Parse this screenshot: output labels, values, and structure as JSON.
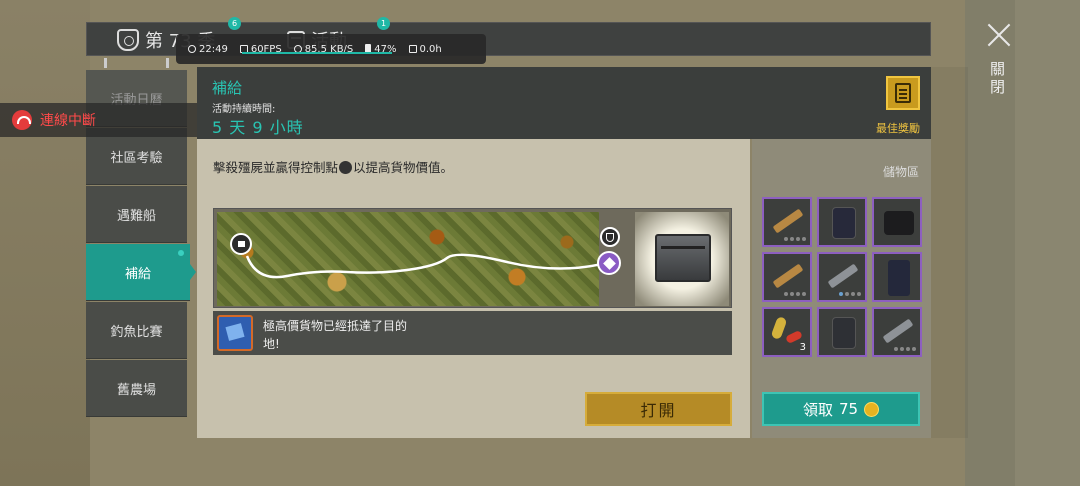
{
  "top_tabs": {
    "season_label": "第 73 季",
    "season_badge": "6",
    "event_label": "活動",
    "event_badge": "1"
  },
  "status_bar": {
    "time": "22:49",
    "fps": "60FPS",
    "network": "85.5 KB/S",
    "battery": "47%",
    "storage": "0.0h"
  },
  "close": {
    "label": "關閉"
  },
  "connection": {
    "text": "連線中斷"
  },
  "sidebar": {
    "items": [
      {
        "label": "活動日曆",
        "active": false
      },
      {
        "label": "社區考驗",
        "active": false
      },
      {
        "label": "遇難船",
        "active": false
      },
      {
        "label": "補給",
        "active": true
      },
      {
        "label": "釣魚比賽",
        "active": false
      },
      {
        "label": "舊農場",
        "active": false
      }
    ]
  },
  "header": {
    "title": "補給",
    "duration_label": "活動持續時間:",
    "duration_value": "5 天 9 小時",
    "reward_label": "最佳獎勵"
  },
  "main": {
    "description_part1": "擊殺殭屍並贏得控制點",
    "description_part2": "以提高貨物價值。",
    "message": "極高價貨物已經抵達了目的地!",
    "open_button": "打開"
  },
  "storage": {
    "label": "儲物區",
    "items": [
      {
        "type": "rifle",
        "count": ""
      },
      {
        "type": "vest",
        "count": ""
      },
      {
        "type": "boots",
        "count": ""
      },
      {
        "type": "rifle",
        "count": ""
      },
      {
        "type": "rifle-dark",
        "count": ""
      },
      {
        "type": "pants",
        "count": ""
      },
      {
        "type": "ammo",
        "count": "3"
      },
      {
        "type": "armor",
        "count": ""
      },
      {
        "type": "rifle-dark",
        "count": ""
      }
    ],
    "claim_label": "領取",
    "claim_cost": "75"
  },
  "colors": {
    "accent": "#1e9b8d",
    "title_teal": "#29c4b2",
    "gold": "#b58b26",
    "error_red": "#ff4a4a",
    "rarity_purple": "#8d5fc0"
  }
}
